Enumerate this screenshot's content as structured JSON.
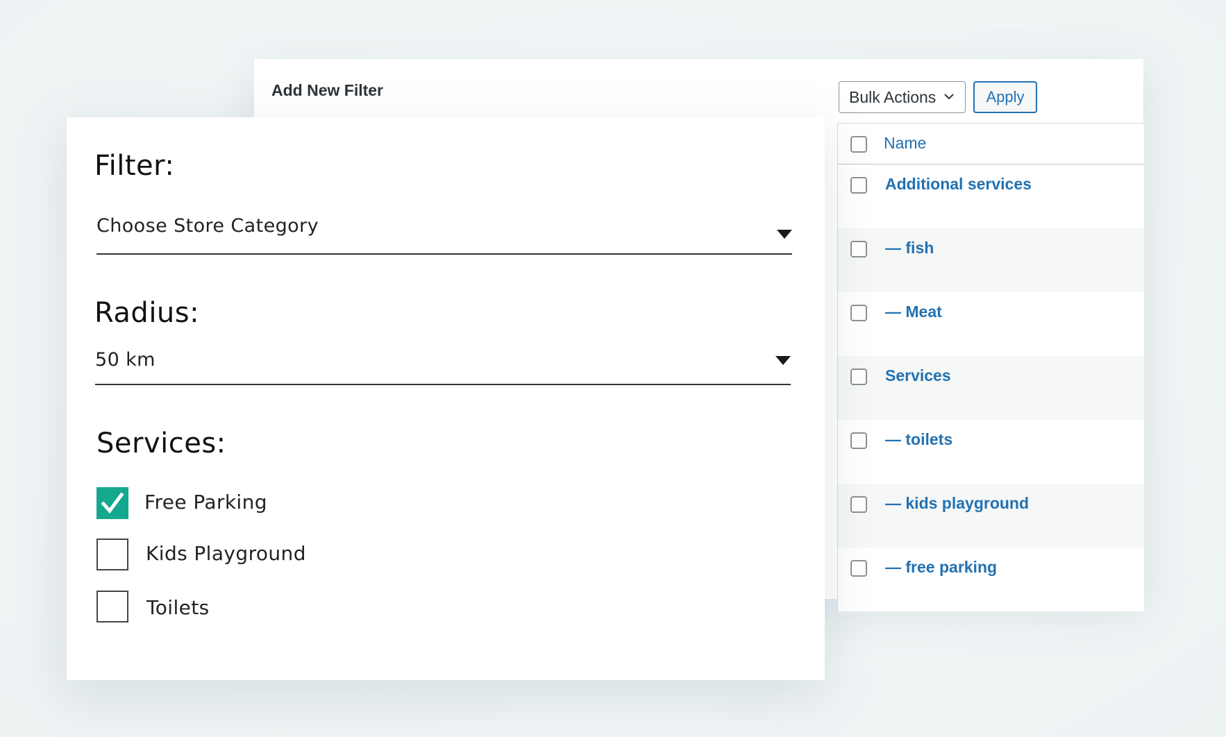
{
  "admin": {
    "title": "Add New Filter",
    "bulk_actions_label": "Bulk Actions",
    "apply_label": "Apply",
    "table": {
      "column_name": "Name",
      "rows": [
        "Additional services",
        "— fish",
        "— Meat",
        "Services",
        "— toilets",
        "— kids playground",
        "— free parking"
      ]
    }
  },
  "filter_form": {
    "filter_heading": "Filter:",
    "filter_value": "Choose Store Category",
    "radius_heading": "Radius:",
    "radius_value": "50 km",
    "services_heading": "Services:",
    "services": [
      {
        "label": "Free Parking",
        "checked": true
      },
      {
        "label": "Kids Playground",
        "checked": false
      },
      {
        "label": "Toilets",
        "checked": false
      }
    ]
  },
  "colors": {
    "accent_link": "#2271b1",
    "check_teal": "#14a98f"
  },
  "icons": {
    "dropdown": "triangle-down-icon",
    "bulk_chevron": "chevron-down-icon",
    "check": "checkmark-icon"
  }
}
